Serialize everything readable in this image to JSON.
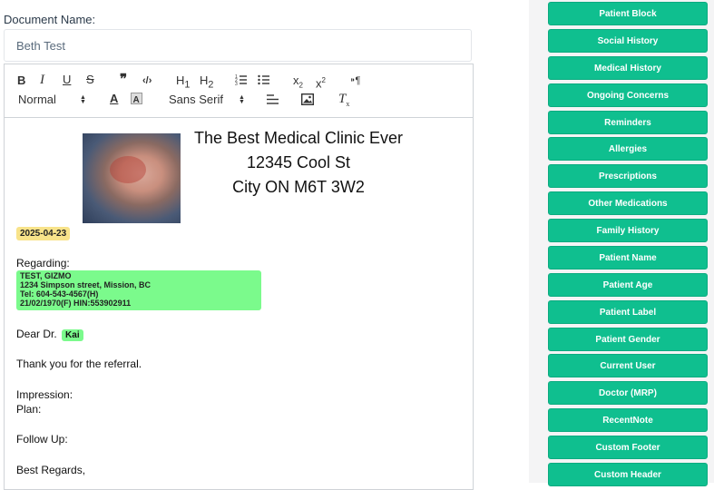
{
  "document": {
    "name_label": "Document Name:",
    "name_value": "Beth Test"
  },
  "toolbar": {
    "bold": "B",
    "italic": "I",
    "underline": "U",
    "strike": "S",
    "quote": "❞",
    "code": "‹/›",
    "h1": "H",
    "h1_sub": "1",
    "h2": "H",
    "h2_sub": "2",
    "subscript": "x",
    "subscript_sub": "2",
    "superscript": "x",
    "superscript_sup": "2",
    "rtl": "⁍¶",
    "size_select": "Normal",
    "font_select": "Sans Serif",
    "clear": "T"
  },
  "letter": {
    "clinic_name": "The Best Medical Clinic Ever",
    "clinic_address": "12345 Cool St",
    "clinic_city": "City ON M6T 3W2",
    "date": "2025-04-23",
    "regarding": "Regarding:",
    "patient_name": "TEST, GIZMO",
    "patient_address": "1234 Simpson street, Mission, BC",
    "patient_tel": "Tel: 604-543-4567(H)",
    "patient_dob_hin": "21/02/1970(F) HIN:553902911",
    "greeting": "Dear Dr.",
    "doctor": "Kai",
    "thanks": "Thank you for the referral.",
    "impression": "Impression:",
    "plan": "Plan:",
    "follow_up": "Follow Up:",
    "closing": "Best Regards,"
  },
  "sidebar": {
    "items": [
      "Patient Block",
      "Social History",
      "Medical History",
      "Ongoing Concerns",
      "Reminders",
      "Allergies",
      "Prescriptions",
      "Other Medications",
      "Family History",
      "Patient Name",
      "Patient Age",
      "Patient Label",
      "Patient Gender",
      "Current User",
      "Doctor (MRP)",
      "RecentNote",
      "Custom Footer",
      "Custom Header"
    ]
  },
  "colors": {
    "accent_button": "#0fbf8f",
    "date_highlight": "#f8e38a",
    "patient_highlight": "#7bfa8c"
  }
}
